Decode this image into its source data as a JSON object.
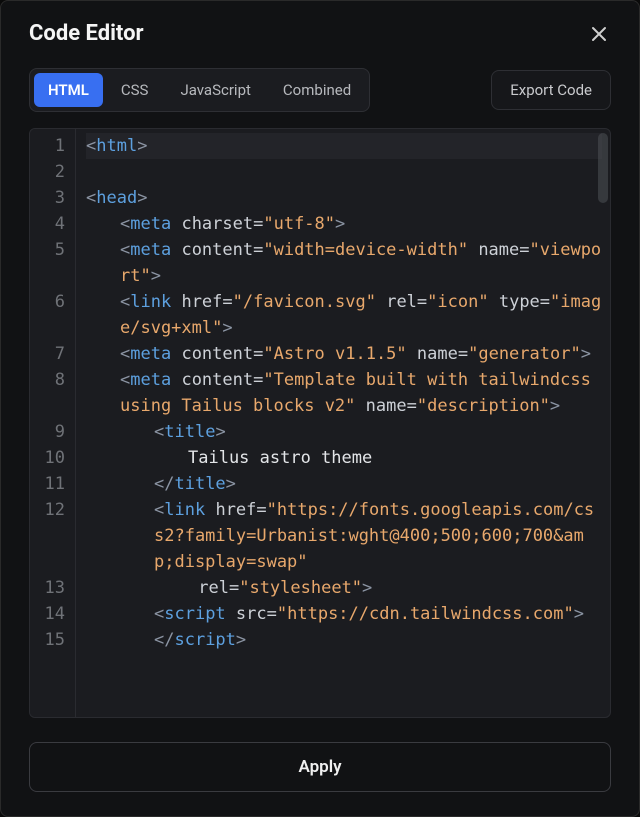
{
  "header": {
    "title": "Code Editor"
  },
  "tabs": {
    "html": "HTML",
    "css": "CSS",
    "js": "JavaScript",
    "combined": "Combined",
    "active": "html"
  },
  "toolbar": {
    "export_label": "Export Code"
  },
  "footer": {
    "apply_label": "Apply"
  },
  "editor": {
    "language": "html",
    "lines": [
      {
        "num": 1,
        "highlight": true,
        "indent": 0,
        "tokens": [
          {
            "t": "bracket",
            "v": "<"
          },
          {
            "t": "tag",
            "v": "html"
          },
          {
            "t": "bracket",
            "v": ">"
          }
        ]
      },
      {
        "num": 2,
        "indent": 0,
        "tokens": []
      },
      {
        "num": 3,
        "indent": 0,
        "tokens": [
          {
            "t": "bracket",
            "v": "<"
          },
          {
            "t": "tag",
            "v": "head"
          },
          {
            "t": "bracket",
            "v": ">"
          }
        ]
      },
      {
        "num": 4,
        "indent": 1,
        "tokens": [
          {
            "t": "bracket",
            "v": "<"
          },
          {
            "t": "tag",
            "v": "meta"
          },
          {
            "t": "text",
            "v": " "
          },
          {
            "t": "attr",
            "v": "charset"
          },
          {
            "t": "eq",
            "v": "="
          },
          {
            "t": "str",
            "v": "\"utf-8\""
          },
          {
            "t": "bracket",
            "v": ">"
          }
        ]
      },
      {
        "num": 5,
        "indent": 1,
        "tokens": [
          {
            "t": "bracket",
            "v": "<"
          },
          {
            "t": "tag",
            "v": "meta"
          },
          {
            "t": "text",
            "v": " "
          },
          {
            "t": "attr",
            "v": "content"
          },
          {
            "t": "eq",
            "v": "="
          },
          {
            "t": "str",
            "v": "\"width=device-width\""
          },
          {
            "t": "text",
            "v": " "
          },
          {
            "t": "attr",
            "v": "name"
          },
          {
            "t": "eq",
            "v": "="
          },
          {
            "t": "str",
            "v": "\"viewport\""
          },
          {
            "t": "bracket",
            "v": ">"
          }
        ]
      },
      {
        "num": 6,
        "indent": 1,
        "tokens": [
          {
            "t": "bracket",
            "v": "<"
          },
          {
            "t": "tag",
            "v": "link"
          },
          {
            "t": "text",
            "v": " "
          },
          {
            "t": "attr",
            "v": "href"
          },
          {
            "t": "eq",
            "v": "="
          },
          {
            "t": "str",
            "v": "\"/favicon.svg\""
          },
          {
            "t": "text",
            "v": " "
          },
          {
            "t": "attr",
            "v": "rel"
          },
          {
            "t": "eq",
            "v": "="
          },
          {
            "t": "str",
            "v": "\"icon\""
          },
          {
            "t": "text",
            "v": " "
          },
          {
            "t": "attr",
            "v": "type"
          },
          {
            "t": "eq",
            "v": "="
          },
          {
            "t": "str",
            "v": "\"image/svg+xml\""
          },
          {
            "t": "bracket",
            "v": ">"
          }
        ]
      },
      {
        "num": 7,
        "indent": 1,
        "tokens": [
          {
            "t": "bracket",
            "v": "<"
          },
          {
            "t": "tag",
            "v": "meta"
          },
          {
            "t": "text",
            "v": " "
          },
          {
            "t": "attr",
            "v": "content"
          },
          {
            "t": "eq",
            "v": "="
          },
          {
            "t": "str",
            "v": "\"Astro v1.1.5\""
          },
          {
            "t": "text",
            "v": " "
          },
          {
            "t": "attr",
            "v": "name"
          },
          {
            "t": "eq",
            "v": "="
          },
          {
            "t": "str",
            "v": "\"generator\""
          },
          {
            "t": "bracket",
            "v": ">"
          }
        ]
      },
      {
        "num": 8,
        "indent": 1,
        "tokens": [
          {
            "t": "bracket",
            "v": "<"
          },
          {
            "t": "tag",
            "v": "meta"
          },
          {
            "t": "text",
            "v": " "
          },
          {
            "t": "attr",
            "v": "content"
          },
          {
            "t": "eq",
            "v": "="
          },
          {
            "t": "str",
            "v": "\"Template built with tailwindcss using Tailus blocks v2\""
          },
          {
            "t": "text",
            "v": " "
          },
          {
            "t": "attr",
            "v": "name"
          },
          {
            "t": "eq",
            "v": "="
          },
          {
            "t": "str",
            "v": "\"description\""
          },
          {
            "t": "bracket",
            "v": ">"
          }
        ]
      },
      {
        "num": 9,
        "indent": 2,
        "tokens": [
          {
            "t": "bracket",
            "v": "<"
          },
          {
            "t": "tag",
            "v": "title"
          },
          {
            "t": "bracket",
            "v": ">"
          }
        ]
      },
      {
        "num": 10,
        "indent": 3,
        "tokens": [
          {
            "t": "text",
            "v": "Tailus astro theme"
          }
        ]
      },
      {
        "num": 11,
        "indent": 2,
        "tokens": [
          {
            "t": "bracket",
            "v": "</"
          },
          {
            "t": "tag",
            "v": "title"
          },
          {
            "t": "bracket",
            "v": ">"
          }
        ]
      },
      {
        "num": 12,
        "indent": 2,
        "tokens": [
          {
            "t": "bracket",
            "v": "<"
          },
          {
            "t": "tag",
            "v": "link"
          },
          {
            "t": "text",
            "v": " "
          },
          {
            "t": "attr",
            "v": "href"
          },
          {
            "t": "eq",
            "v": "="
          },
          {
            "t": "str",
            "v": "\"https://fonts.googleapis.com/css2?family=Urbanist:wght@400;500;600;700&amp;display=swap\""
          }
        ]
      },
      {
        "num": 13,
        "indent": 3,
        "tokens": [
          {
            "t": "text",
            "v": " "
          },
          {
            "t": "attr",
            "v": "rel"
          },
          {
            "t": "eq",
            "v": "="
          },
          {
            "t": "str",
            "v": "\"stylesheet\""
          },
          {
            "t": "bracket",
            "v": ">"
          }
        ]
      },
      {
        "num": 14,
        "indent": 2,
        "tokens": [
          {
            "t": "bracket",
            "v": "<"
          },
          {
            "t": "tag",
            "v": "script"
          },
          {
            "t": "text",
            "v": " "
          },
          {
            "t": "attr",
            "v": "src"
          },
          {
            "t": "eq",
            "v": "="
          },
          {
            "t": "str",
            "v": "\"https://cdn.tailwindcss.com\""
          },
          {
            "t": "bracket",
            "v": ">"
          }
        ]
      },
      {
        "num": 15,
        "indent": 2,
        "tokens": [
          {
            "t": "bracket",
            "v": "</"
          },
          {
            "t": "tag",
            "v": "script"
          },
          {
            "t": "bracket",
            "v": ">"
          }
        ]
      }
    ]
  }
}
